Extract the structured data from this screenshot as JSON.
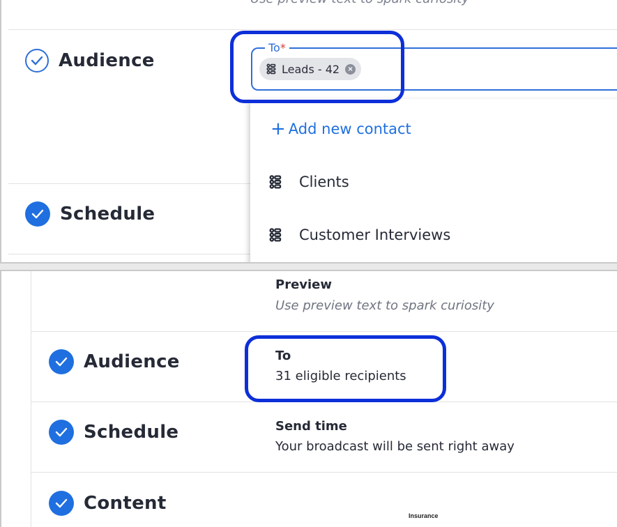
{
  "top_panel": {
    "cut_preview_text": "Use preview text to spark curiosity",
    "steps": {
      "audience": "Audience",
      "schedule": "Schedule"
    },
    "to_field": {
      "label": "To",
      "required_marker": "*",
      "chip_label": "Leads - 42"
    },
    "dropdown": {
      "add_contact_plus": "+",
      "add_contact_label": "Add new contact",
      "items": [
        "Clients",
        "Customer Interviews"
      ]
    }
  },
  "bottom_panel": {
    "preview": {
      "heading": "Preview",
      "placeholder": "Use preview text to spark curiosity"
    },
    "steps": {
      "audience": "Audience",
      "schedule": "Schedule",
      "content": "Content"
    },
    "to": {
      "heading": "To",
      "value": "31 eligible recipients"
    },
    "send_time": {
      "heading": "Send time",
      "value": "Your broadcast will be sent right away"
    },
    "content_thumbnail_text": "Insurance"
  },
  "colors": {
    "accent": "#1f6fe0",
    "highlight": "#0d2fd9",
    "required": "#d23c3c"
  },
  "icons": {
    "list_icon": "list-group-icon",
    "check_outline": "check-circle-outline-icon",
    "check_filled": "check-circle-filled-icon",
    "chip_remove": "close-circle-icon"
  }
}
